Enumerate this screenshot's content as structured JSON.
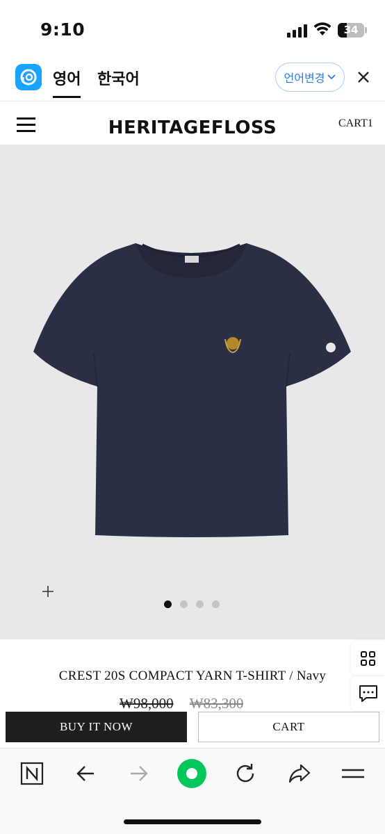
{
  "status": {
    "time": "9:10",
    "battery": "34",
    "battery_level": 0.34
  },
  "translate_bar": {
    "tab_active": "영어",
    "tab_other": "한국어",
    "change_button": "언어변경"
  },
  "shop": {
    "brand": "HERITAGEFLOSS",
    "cart_label": "CART1"
  },
  "gallery": {
    "total_slides": 4,
    "active_slide": 1
  },
  "product": {
    "title": "CREST 20S COMPACT YARN T-SHIRT / Navy",
    "price_original": "₩98,000",
    "price_sale": "₩83,300"
  },
  "actions": {
    "buy_now": "BUY IT NOW",
    "cart": "CART"
  },
  "colors": {
    "accent_blue": "#2b7de1",
    "papago_blue": "#1aa3ff",
    "naver_green": "#03c75a",
    "shirt_navy": "#2a2f45",
    "image_bg": "#e8e8ea"
  },
  "icons": {
    "menu": "hamburger-icon",
    "close": "close-icon",
    "grid": "grid-icon",
    "chat": "chat-icon",
    "zoom": "plus-icon",
    "nav": [
      "n-logo-icon",
      "back-arrow-icon",
      "forward-arrow-icon",
      "green-dot-icon",
      "refresh-icon",
      "share-icon",
      "menu-lines-icon"
    ]
  }
}
